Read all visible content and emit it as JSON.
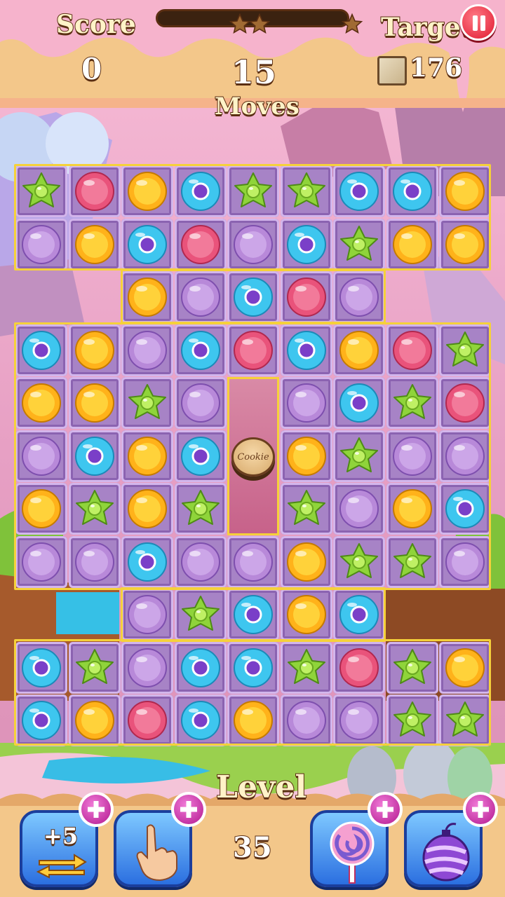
{
  "hud": {
    "score_label": "Score",
    "score_value": "0",
    "moves_value": "15",
    "moves_label": "Moves",
    "target_label": "Target",
    "target_value": "176",
    "progress_stars": 3,
    "progress_fraction": 0
  },
  "board": {
    "cookie_label": "Cookie",
    "cols": 9,
    "rows": 11,
    "legend": {
      "S": "green-star-candy",
      "R": "pink-round-candy",
      "Y": "orange-round-candy",
      "B": "blue-ring-candy",
      "P": "purple-round-candy",
      "C": "cookie-blocker",
      ".": "empty"
    },
    "grid": [
      [
        "S",
        "R",
        "Y",
        "B",
        "S",
        "S",
        "B",
        "B",
        "Y"
      ],
      [
        "P",
        "Y",
        "B",
        "R",
        "P",
        "B",
        "S",
        "Y",
        "Y"
      ],
      [
        ".",
        ".",
        "Y",
        "P",
        "B",
        "R",
        "P",
        ".",
        "."
      ],
      [
        "B",
        "Y",
        "P",
        "B",
        "R",
        "B",
        "Y",
        "R",
        "S"
      ],
      [
        "Y",
        "Y",
        "S",
        "P",
        ".",
        "P",
        "B",
        "S",
        "R"
      ],
      [
        "P",
        "B",
        "Y",
        "B",
        "C",
        "Y",
        "S",
        "P",
        "P"
      ],
      [
        "Y",
        "S",
        "Y",
        "S",
        ".",
        "S",
        "P",
        "Y",
        "B"
      ],
      [
        "P",
        "P",
        "B",
        "P",
        "P",
        "Y",
        "S",
        "S",
        "P"
      ],
      [
        ".",
        ".",
        "P",
        "S",
        "B",
        "Y",
        "B",
        ".",
        "."
      ],
      [
        "B",
        "S",
        "P",
        "B",
        "B",
        "S",
        "R",
        "S",
        "Y"
      ],
      [
        "B",
        "Y",
        "R",
        "B",
        "Y",
        "P",
        "P",
        "S",
        "S"
      ]
    ]
  },
  "footer": {
    "level_label": "Level",
    "level_value": "35",
    "booster_moves_label": "+5",
    "boosters": [
      "extra-moves",
      "hand-swap",
      "lollipop-hammer",
      "color-bomb"
    ]
  },
  "colors": {
    "candy_green": "#8fd43a",
    "candy_pink": "#e9537b",
    "candy_orange": "#ffb21a",
    "candy_blue": "#3ec6ef",
    "candy_purple": "#b889d9",
    "board_border": "#f5d13a"
  }
}
